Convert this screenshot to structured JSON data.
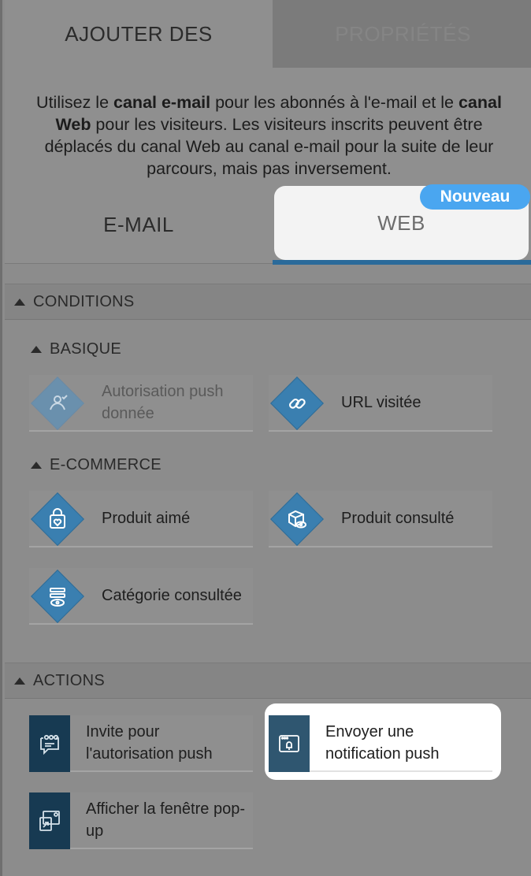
{
  "top_tabs": {
    "add": "AJOUTER DES",
    "properties": "PROPRIÉTÉS"
  },
  "intro": {
    "part1": "Utilisez le ",
    "email_channel": "canal e-mail",
    "part2": " pour les abonnés à l'e-mail et le ",
    "web_channel": "canal Web",
    "part3": " pour les visiteurs. Les visiteurs inscrits peuvent être déplacés du canal Web au canal e-mail pour la suite de leur parcours, mais pas inversement."
  },
  "channel_tabs": {
    "email": "E-MAIL",
    "web": "WEB",
    "new_badge": "Nouveau",
    "selected": "WEB"
  },
  "conditions": {
    "title": "CONDITIONS",
    "basic": {
      "title": "BASIQUE",
      "items": [
        {
          "label": "Autorisation push donnée",
          "icon": "push-permission-icon",
          "disabled": true
        },
        {
          "label": "URL visitée",
          "icon": "link-icon",
          "disabled": false
        }
      ]
    },
    "ecommerce": {
      "title": "E-COMMERCE",
      "items": [
        {
          "label": "Produit aimé",
          "icon": "bag-heart-icon"
        },
        {
          "label": "Produit consulté",
          "icon": "box-eye-icon"
        },
        {
          "label": "Catégorie consultée",
          "icon": "list-eye-icon"
        }
      ]
    }
  },
  "actions": {
    "title": "ACTIONS",
    "items": [
      {
        "label": "Invite pour l'autorisation push",
        "icon": "prompt-bubble-icon"
      },
      {
        "label": "Envoyer une notification push",
        "icon": "bell-window-icon",
        "highlighted": true
      },
      {
        "label": "Afficher la fenêtre pop-up",
        "icon": "popup-window-icon"
      }
    ]
  },
  "colors": {
    "accent_blue": "#3a7fb0",
    "badge_blue": "#4aa6f0",
    "action_navy": "#173a52",
    "tab_underline": "#2a6a9a"
  }
}
